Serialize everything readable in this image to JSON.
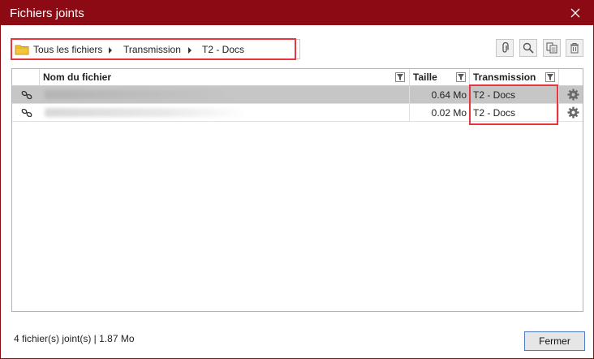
{
  "window": {
    "title": "Fichiers joints",
    "title_bar_color": "#8c0a14",
    "highlight_color": "#e8353f"
  },
  "breadcrumb": {
    "folder_icon": "folder-icon",
    "items": [
      "Tous les fichiers",
      "Transmission",
      "T2 - Docs"
    ]
  },
  "toolbar": {
    "buttons": [
      "attach-icon",
      "search-icon",
      "copy-document-icon",
      "trash-icon"
    ]
  },
  "grid": {
    "columns": {
      "name": "Nom du fichier",
      "size": "Taille",
      "transmission": "Transmission"
    },
    "rows": [
      {
        "size": "0.64 Mo",
        "transmission": "T2 - Docs",
        "selected": true
      },
      {
        "size": "0.02 Mo",
        "transmission": "T2 - Docs",
        "selected": false
      }
    ]
  },
  "status": {
    "summary": "4 fichier(s) joint(s) | 1.87 Mo"
  },
  "footer": {
    "close_label": "Fermer"
  }
}
